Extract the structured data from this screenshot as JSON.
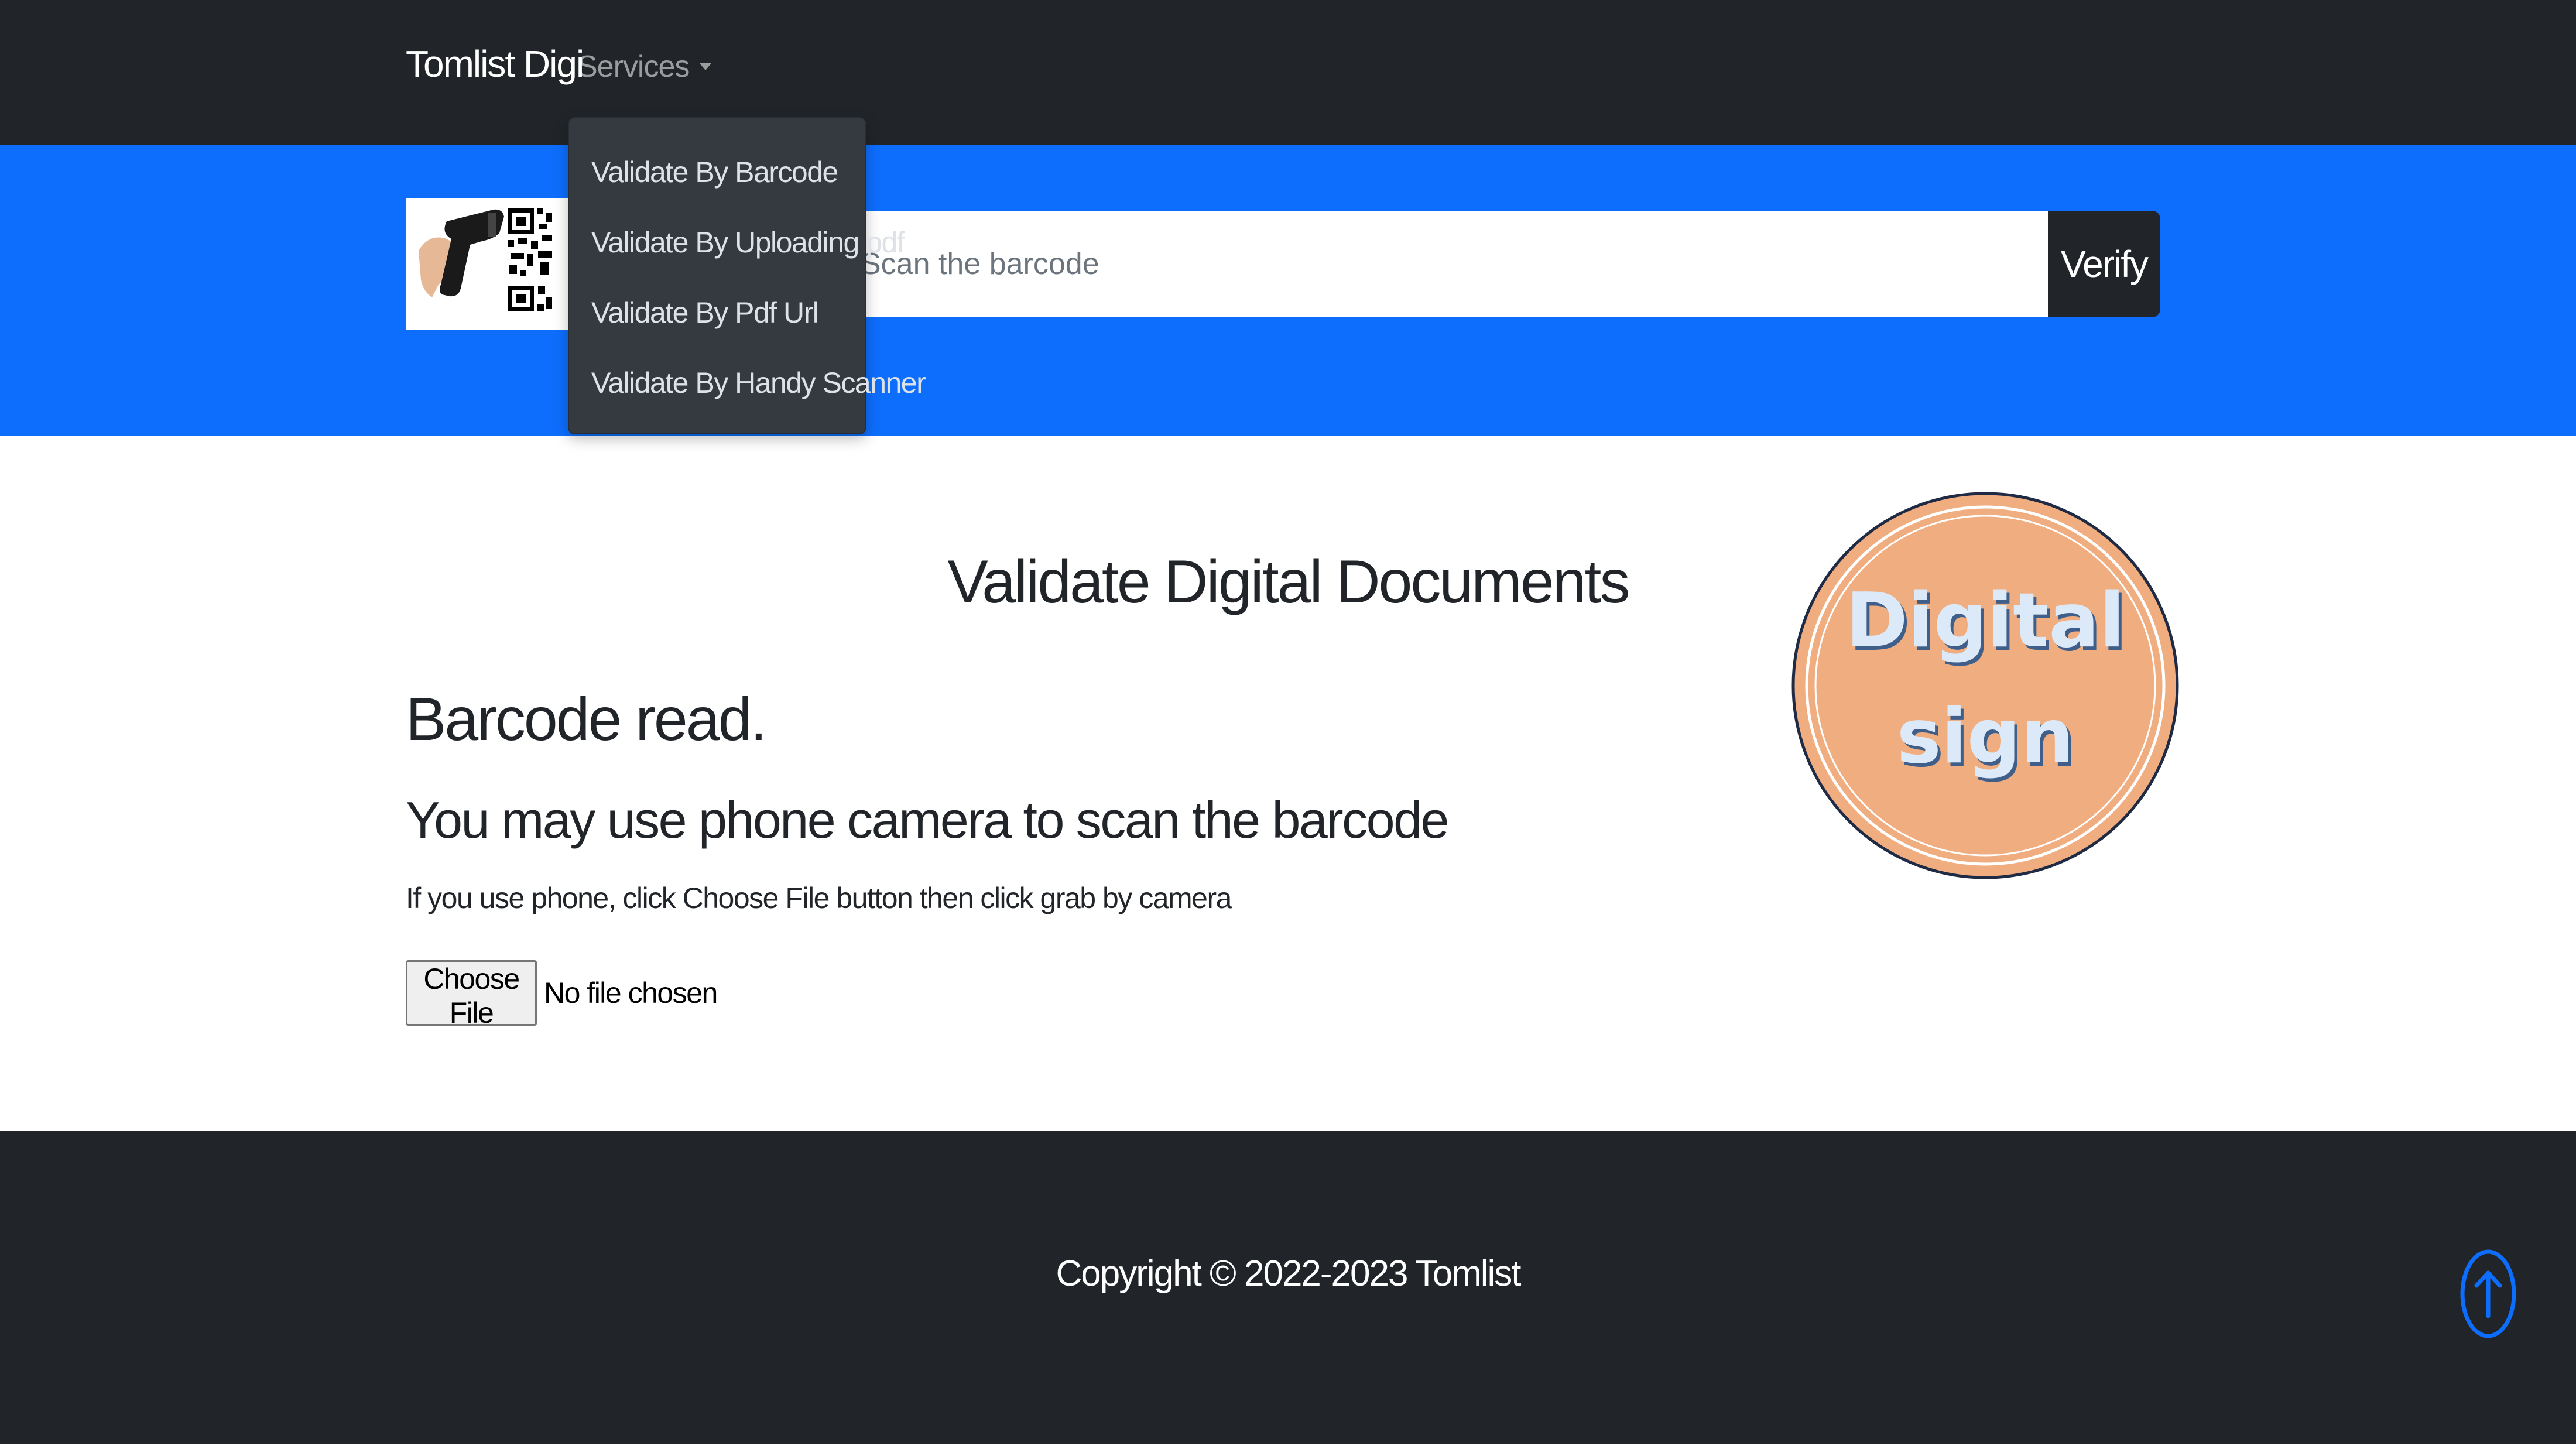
{
  "navbar": {
    "brand": "Tomlist Digi",
    "services_label": "Services"
  },
  "dropdown": {
    "items": [
      {
        "label": "Validate By Barcode"
      },
      {
        "label": "Validate By Uploading pdf"
      },
      {
        "label": "Validate By Pdf Url"
      },
      {
        "label": "Validate By Handy Scanner"
      }
    ]
  },
  "search": {
    "placeholder": "Scan the barcode",
    "verify_label": "Verify"
  },
  "main": {
    "title": "Validate Digital Documents",
    "status_heading": "Barcode read.",
    "phone_heading": "You may use phone camera to scan the barcode",
    "help_text": "If you use phone, click Choose File button then click grab by camera",
    "choose_file_label": "Choose File",
    "no_file_text": "No file chosen"
  },
  "seal": {
    "line1": "Digital",
    "line2": "sign"
  },
  "footer": {
    "copyright": "Copyright © 2022-2023 Tomlist"
  },
  "colors": {
    "navbar_bg": "#212529",
    "primary_blue": "#0d6efd",
    "dropdown_bg": "#343a40",
    "seal_fill": "#f0ad80",
    "seal_text": "#dbe9f8"
  },
  "icons": {
    "caret": "caret-down-icon",
    "scanner": "barcode-scanner-icon",
    "scroll_top": "arrow-up-circle-icon"
  }
}
